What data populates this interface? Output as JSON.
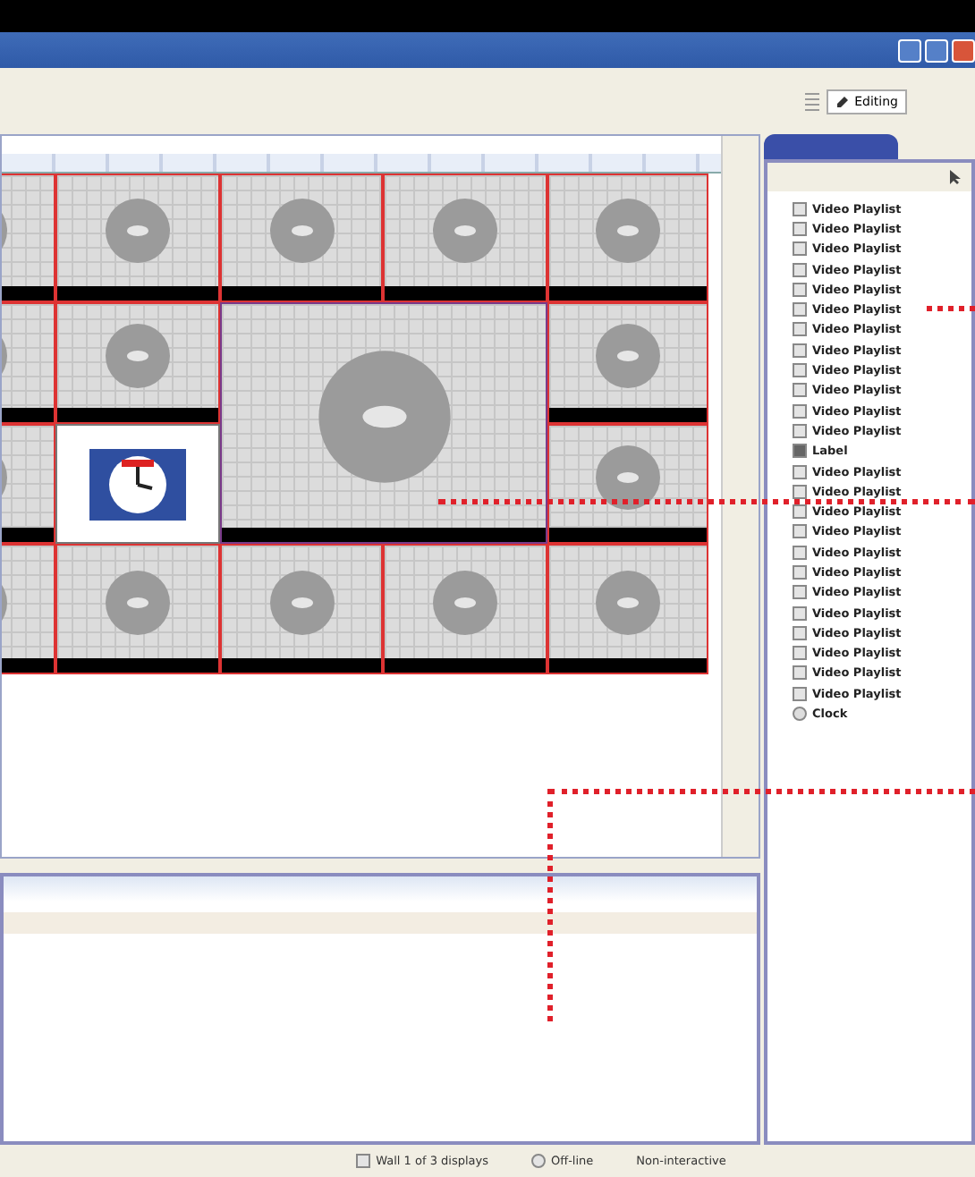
{
  "toolbar": {
    "button": "Editing"
  },
  "wall": {
    "tiles": [
      {
        "kind": "pattern"
      },
      {
        "kind": "pattern"
      },
      {
        "kind": "pattern"
      },
      {
        "kind": "pattern"
      },
      {
        "kind": "pattern"
      },
      {
        "kind": "pattern"
      },
      {
        "kind": "pattern"
      },
      {
        "kind": "pattern-large"
      },
      {
        "kind": "pattern"
      },
      {
        "kind": "pattern"
      },
      {
        "kind": "clock"
      },
      {
        "kind": "pattern"
      },
      {
        "kind": "pattern"
      },
      {
        "kind": "pattern"
      },
      {
        "kind": "pattern"
      },
      {
        "kind": "pattern"
      },
      {
        "kind": "pattern"
      }
    ]
  },
  "sources": {
    "items": [
      {
        "kind": "video",
        "label": "Video Playlist"
      },
      {
        "kind": "video",
        "label": "Video Playlist"
      },
      {
        "kind": "video",
        "label": "Video Playlist"
      },
      {
        "kind": "video",
        "label": "Video Playlist"
      },
      {
        "kind": "video",
        "label": "Video Playlist"
      },
      {
        "kind": "video",
        "label": "Video Playlist"
      },
      {
        "kind": "video",
        "label": "Video Playlist"
      },
      {
        "kind": "video",
        "label": "Video Playlist"
      },
      {
        "kind": "video",
        "label": "Video Playlist"
      },
      {
        "kind": "video",
        "label": "Video Playlist"
      },
      {
        "kind": "video",
        "label": "Video Playlist"
      },
      {
        "kind": "video",
        "label": "Video Playlist"
      },
      {
        "kind": "label",
        "label": "Label"
      },
      {
        "kind": "video",
        "label": "Video Playlist"
      },
      {
        "kind": "video",
        "label": "Video Playlist"
      },
      {
        "kind": "video",
        "label": "Video Playlist"
      },
      {
        "kind": "video",
        "label": "Video Playlist"
      },
      {
        "kind": "video",
        "label": "Video Playlist"
      },
      {
        "kind": "video",
        "label": "Video Playlist"
      },
      {
        "kind": "video",
        "label": "Video Playlist"
      },
      {
        "kind": "video",
        "label": "Video Playlist"
      },
      {
        "kind": "video",
        "label": "Video Playlist"
      },
      {
        "kind": "video",
        "label": "Video Playlist"
      },
      {
        "kind": "video",
        "label": "Video Playlist"
      },
      {
        "kind": "video",
        "label": "Video Playlist"
      },
      {
        "kind": "clock",
        "label": "Clock"
      }
    ]
  },
  "status_bar": [
    "Wall 1 of 3 displays",
    "Off-line",
    "Non-interactive"
  ]
}
